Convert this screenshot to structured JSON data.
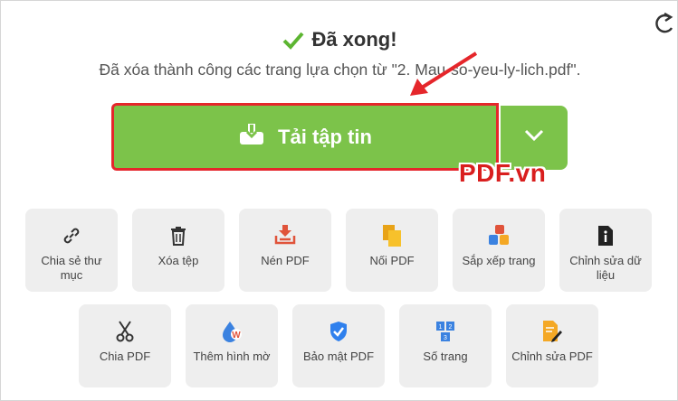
{
  "status": {
    "title": "Đã xong!",
    "message": "Đã xóa thành công các trang lựa chọn từ \"2. Mau-so-yeu-ly-lich.pdf\"."
  },
  "download": {
    "label": "Tải tập tin"
  },
  "watermark": "PDF.vn",
  "tools_row1": [
    {
      "label": "Chia sẻ thư mục",
      "icon": "link-icon"
    },
    {
      "label": "Xóa tệp",
      "icon": "trash-icon"
    },
    {
      "label": "Nén PDF",
      "icon": "compress-icon"
    },
    {
      "label": "Nối PDF",
      "icon": "merge-icon"
    },
    {
      "label": "Sắp xếp trang",
      "icon": "organize-icon"
    },
    {
      "label": "Chỉnh sửa dữ liệu",
      "icon": "info-icon"
    }
  ],
  "tools_row2": [
    {
      "label": "Chia PDF",
      "icon": "scissors-icon"
    },
    {
      "label": "Thêm hình mờ",
      "icon": "watermark-icon"
    },
    {
      "label": "Bảo mật PDF",
      "icon": "shield-icon"
    },
    {
      "label": "Số trang",
      "icon": "page-numbers-icon"
    },
    {
      "label": "Chỉnh sửa PDF",
      "icon": "edit-pdf-icon"
    }
  ],
  "colors": {
    "accent_green": "#7cc34a",
    "highlight_red": "#e5262b",
    "tile_bg": "#eeeeee"
  }
}
